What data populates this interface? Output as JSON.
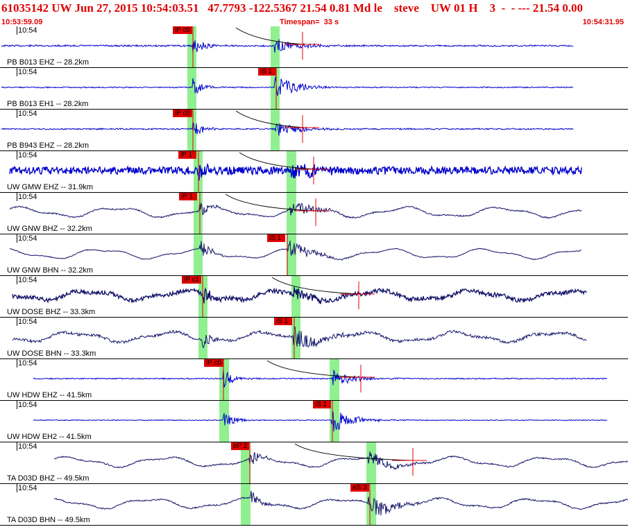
{
  "header": {
    "title": "61035142 UW Jun 27, 2015 10:54:03.51   47.7793 -122.5367 21.54 0.81 Md le    steve    UW 01 H    3  -  - --- 21.54 0.00",
    "start_time": "10:53:59.09",
    "timespan": "Timespan=  33 s",
    "end_time": "10:54:31.95"
  },
  "colors": {
    "accent": "#e00000",
    "trace_blue": "#0000cc",
    "trace_navy": "#15156b",
    "highlight": "#90f090",
    "phase_bg": "#e00000"
  },
  "panels": [
    {
      "time_label": "10:54",
      "station_label": "PB B013 EHZ -- 28.2km",
      "color": "trace_blue",
      "phases": [
        {
          "label": "iP c0",
          "type": "P"
        }
      ]
    },
    {
      "time_label": "10:54",
      "station_label": "PB B013 EH1 -- 28.2km",
      "color": "trace_blue",
      "phases": [
        {
          "label": "iS 1",
          "type": "S"
        }
      ]
    },
    {
      "time_label": "10:54",
      "station_label": "PB B943 EHZ -- 28.2km",
      "color": "trace_blue",
      "phases": [
        {
          "label": "iP c0",
          "type": "P"
        }
      ]
    },
    {
      "time_label": "10:54",
      "station_label": "UW GMW EHZ -- 31.9km",
      "color": "trace_blue",
      "phases": [
        {
          "label": "iP 1",
          "type": "P"
        }
      ]
    },
    {
      "time_label": "10:54",
      "station_label": "UW GNW BHZ -- 32.2km",
      "color": "trace_navy",
      "phases": [
        {
          "label": "iP 1",
          "type": "P"
        }
      ]
    },
    {
      "time_label": "10:54",
      "station_label": "UW GNW BHN -- 32.2km",
      "color": "trace_navy",
      "phases": [
        {
          "label": "iS 1",
          "type": "S"
        }
      ]
    },
    {
      "time_label": "10:54",
      "station_label": "UW DOSE BHZ -- 33.3km",
      "color": "trace_navy",
      "phases": [
        {
          "label": "iP c1",
          "type": "P"
        }
      ]
    },
    {
      "time_label": "10:54",
      "station_label": "UW DOSE BHN -- 33.3km",
      "color": "trace_navy",
      "phases": [
        {
          "label": "iS 1",
          "type": "S"
        }
      ]
    },
    {
      "time_label": "10:54",
      "station_label": "UW HDW EHZ -- 41.5km",
      "color": "trace_blue",
      "phases": [
        {
          "label": "iP c0",
          "type": "P"
        }
      ]
    },
    {
      "time_label": "10:54",
      "station_label": "UW HDW EH2 -- 41.5km",
      "color": "trace_blue",
      "phases": [
        {
          "label": "iS 1",
          "type": "S"
        }
      ]
    },
    {
      "time_label": "10:54",
      "station_label": "TA D03D BHZ -- 49.5km",
      "color": "trace_navy",
      "phases": [
        {
          "label": "eP 2",
          "type": "P"
        }
      ]
    },
    {
      "time_label": "10:54",
      "station_label": "TA D03D BHN -- 49.5km",
      "color": "trace_navy",
      "phases": [
        {
          "label": "eS 3",
          "type": "S"
        }
      ]
    }
  ]
}
